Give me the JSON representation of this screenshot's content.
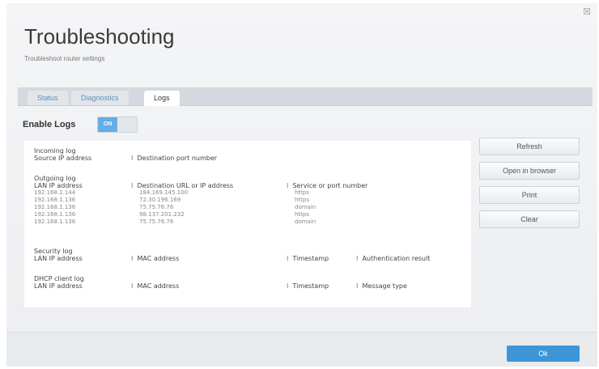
{
  "window": {
    "title": "Troubleshooting",
    "subtitle": "Troubleshoot router settings",
    "close_glyph": "☒"
  },
  "tabs": [
    {
      "label": "Status"
    },
    {
      "label": "Diagnostics"
    },
    {
      "label": "Logs"
    }
  ],
  "logs": {
    "enable_label": "Enable Logs",
    "toggle_state": "ON",
    "incoming": {
      "title": "Incoming log",
      "headers": [
        "Source IP address",
        "Destination port number"
      ]
    },
    "outgoing": {
      "title": "Outgoing log",
      "headers": [
        "LAN IP address",
        "Destination URL or IP address",
        "Service or port number"
      ],
      "rows": [
        [
          "192.168.1.144",
          "184.169.145.100",
          "https"
        ],
        [
          "192.168.1.136",
          "72.30.196.169",
          "https"
        ],
        [
          "192.168.1.136",
          "75.75.76.76",
          "domain"
        ],
        [
          "192.168.1.136",
          "98.137.201.232",
          "https"
        ],
        [
          "192.168.1.136",
          "75.75.76.76",
          "domain"
        ]
      ]
    },
    "security": {
      "title": "Security log",
      "headers": [
        "LAN IP address",
        "MAC address",
        "Timestamp",
        "Authentication result"
      ]
    },
    "dhcp": {
      "title": "DHCP client log",
      "headers": [
        "LAN IP address",
        "MAC address",
        "Timestamp",
        "Message type"
      ]
    },
    "separator": "I"
  },
  "actions": {
    "refresh": "Refresh",
    "open_browser": "Open in browser",
    "print": "Print",
    "clear": "Clear"
  },
  "footer": {
    "ok": "Ok"
  }
}
